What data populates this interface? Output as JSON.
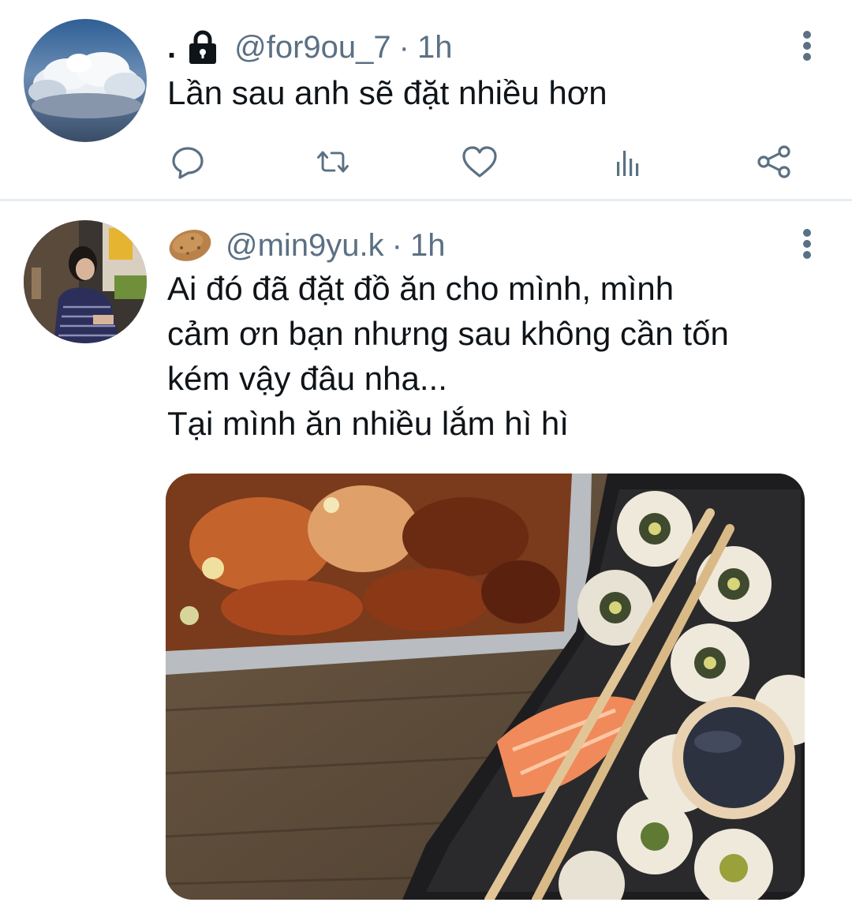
{
  "tweets": [
    {
      "display_name": ".",
      "handle": "@for9ou_7",
      "separator": "·",
      "time": "1h",
      "text": "Lần sau anh sẽ đặt nhiều hơn",
      "avatar_icon": "sky-clouds-avatar",
      "locked": true,
      "actions": [
        "reply-icon",
        "retweet-icon",
        "like-icon",
        "analytics-icon",
        "share-icon"
      ]
    },
    {
      "display_name": "🥔",
      "handle": "@min9yu.k",
      "separator": "·",
      "time": "1h",
      "text": "Ai đó đã đặt đồ ăn cho mình, mình\ncảm ơn bạn nhưng sau không cần tốn\nkém vậy đâu nha...\nTại mình ăn nhiều lắm hì hì",
      "avatar_icon": "person-photo-avatar",
      "media_icon": "food-photo-kimchi-chicken-and-sushi"
    }
  ],
  "colors": {
    "text": "#0f1419",
    "secondary": "#5b7083",
    "divider": "#e6ecf0"
  }
}
